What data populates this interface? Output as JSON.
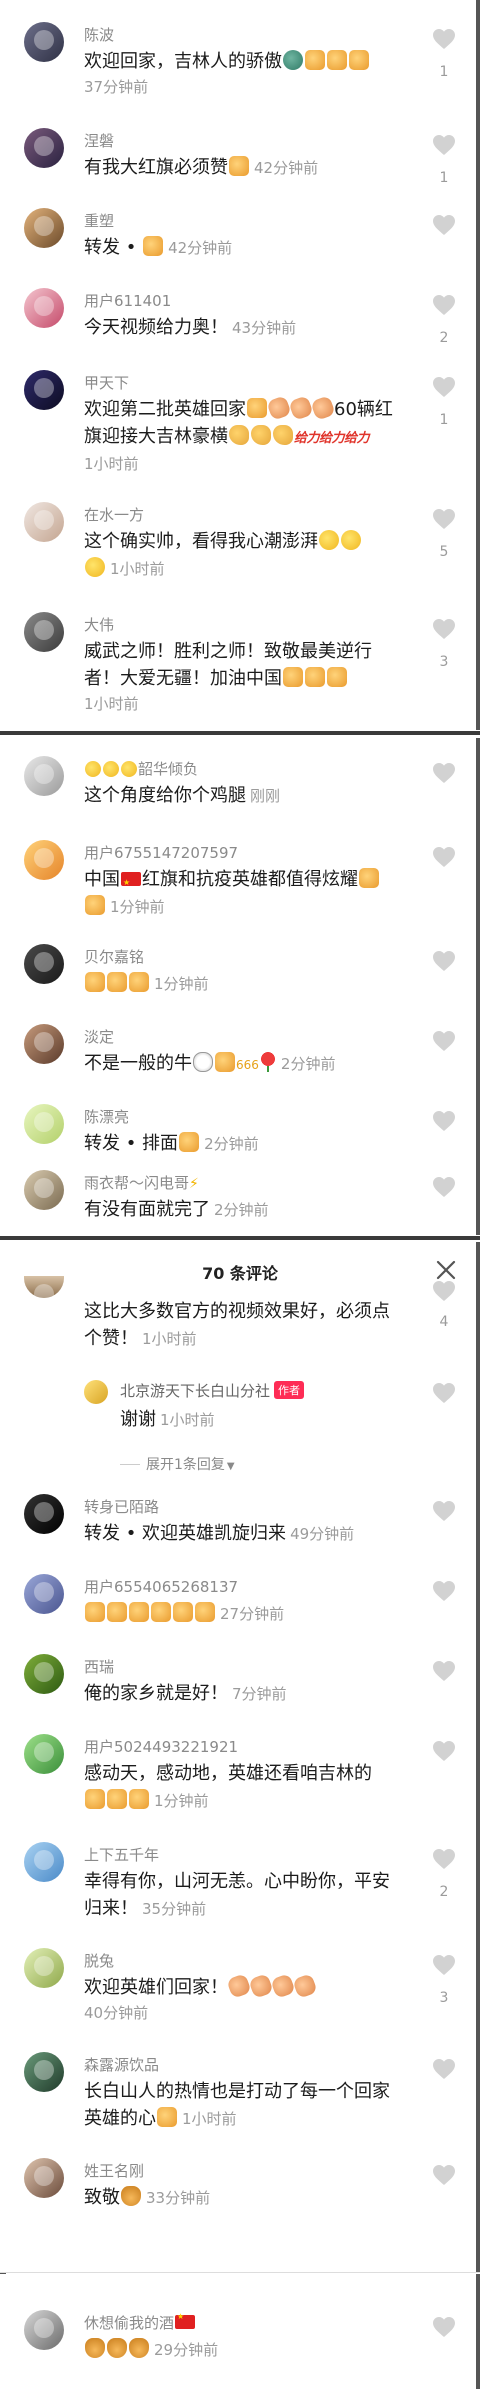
{
  "top_comments": [
    {
      "user": "陈波",
      "parts": [
        "欢迎回家，吉林人的骄傲"
      ],
      "emojis": [
        "proud-emoji",
        "like-emoji",
        "like-emoji",
        "like-emoji"
      ],
      "time": "37分钟前",
      "likes": "1"
    },
    {
      "user": "涅磐",
      "parts": [
        "有我大红旗必须赞"
      ],
      "emojis": [
        "like-emoji"
      ],
      "time": "42分钟前",
      "likes": "1"
    },
    {
      "user": "重塑",
      "parts": [
        "转发 • "
      ],
      "emojis": [
        "like-emoji"
      ],
      "time": "42分钟前",
      "likes": ""
    },
    {
      "user": "用户611401",
      "parts": [
        "今天视频给力奥！"
      ],
      "emojis": [],
      "time": "43分钟前",
      "likes": "2"
    },
    {
      "user": "甲天下",
      "parts": [
        "欢迎第二批英雄回家",
        "60辆红旗迎接大吉林豪横",
        "给力给力给力"
      ],
      "time": "1小时前",
      "likes": "1"
    },
    {
      "user": "在水一方",
      "parts": [
        "这个确实帅，看得我心潮澎湃"
      ],
      "time": "1小时前",
      "likes": "5"
    },
    {
      "user": "大伟",
      "parts": [
        "威武之师！胜利之师！致敬最美逆行者！大爱无疆！加油中国"
      ],
      "time": "1小时前",
      "likes": "3"
    }
  ],
  "middle_comments": [
    {
      "user": "韶华倾负",
      "parts": [
        "这个角度给你个鸡腿"
      ],
      "time": "刚刚",
      "likes": ""
    },
    {
      "user": "用户6755147207597",
      "parts": [
        "中国",
        "红旗和抗疫英雄都值得炫耀"
      ],
      "time": "1分钟前",
      "likes": ""
    },
    {
      "user": "贝尔嘉铭",
      "parts": [
        ""
      ],
      "time": "1分钟前",
      "likes": ""
    },
    {
      "user": "淡定",
      "parts": [
        "不是一般的牛"
      ],
      "time": "2分钟前",
      "likes": ""
    },
    {
      "user": "陈漂亮",
      "parts": [
        "转发 • 排面"
      ],
      "time": "2分钟前",
      "likes": ""
    },
    {
      "user": "雨衣帮～闪电哥",
      "parts": [
        "有没有面就完了"
      ],
      "time": "2分钟前",
      "likes": ""
    }
  ],
  "modal": {
    "title": "70 条评论",
    "first_comment": {
      "parts": [
        "这比大多数官方的视频效果好，必须点个赞！"
      ],
      "time": "1小时前",
      "likes": "4"
    },
    "author_reply": {
      "user": "北京游天下长白山分社",
      "badge": "作者",
      "text": "谢谢",
      "time": "1小时前"
    },
    "expand_label": "展开1条回复",
    "comments": [
      {
        "user": "转身已陌路",
        "parts": [
          "转发 • 欢迎英雄凯旋归来"
        ],
        "time": "49分钟前",
        "likes": ""
      },
      {
        "user": "用户6554065268137",
        "parts": [
          ""
        ],
        "time": "27分钟前",
        "likes": ""
      },
      {
        "user": "西瑞",
        "parts": [
          "俺的家乡就是好！"
        ],
        "time": "7分钟前",
        "likes": ""
      },
      {
        "user": "用户5024493221921",
        "parts": [
          "感动天，感动地，英雄还看咱吉林的"
        ],
        "time": "1分钟前",
        "likes": ""
      },
      {
        "user": "上下五千年",
        "parts": [
          "幸得有你，山河无恙。心中盼你，平安归来！"
        ],
        "time": "35分钟前",
        "likes": "2"
      },
      {
        "user": "脱兔",
        "parts": [
          "欢迎英雄们回家！"
        ],
        "time": "40分钟前",
        "likes": "3"
      },
      {
        "user": "森露源饮品",
        "parts": [
          "长白山人的热情也是打动了每一个回家英雄的心"
        ],
        "time": "1小时前",
        "likes": ""
      },
      {
        "user": "姓王名刚",
        "parts": [
          "致敬"
        ],
        "time": "33分钟前",
        "likes": ""
      }
    ]
  },
  "bottom_comment": {
    "user": "休想偷我的酒",
    "time": "29分钟前",
    "likes": ""
  },
  "colors": {
    "heart": "#c8c8c8",
    "author_badge": "#fe2c55",
    "accent_gold": "#e6a21b"
  },
  "icons": {
    "like_button": "heart-outline-icon",
    "close": "close-icon",
    "expand": "chevron-down-icon"
  }
}
